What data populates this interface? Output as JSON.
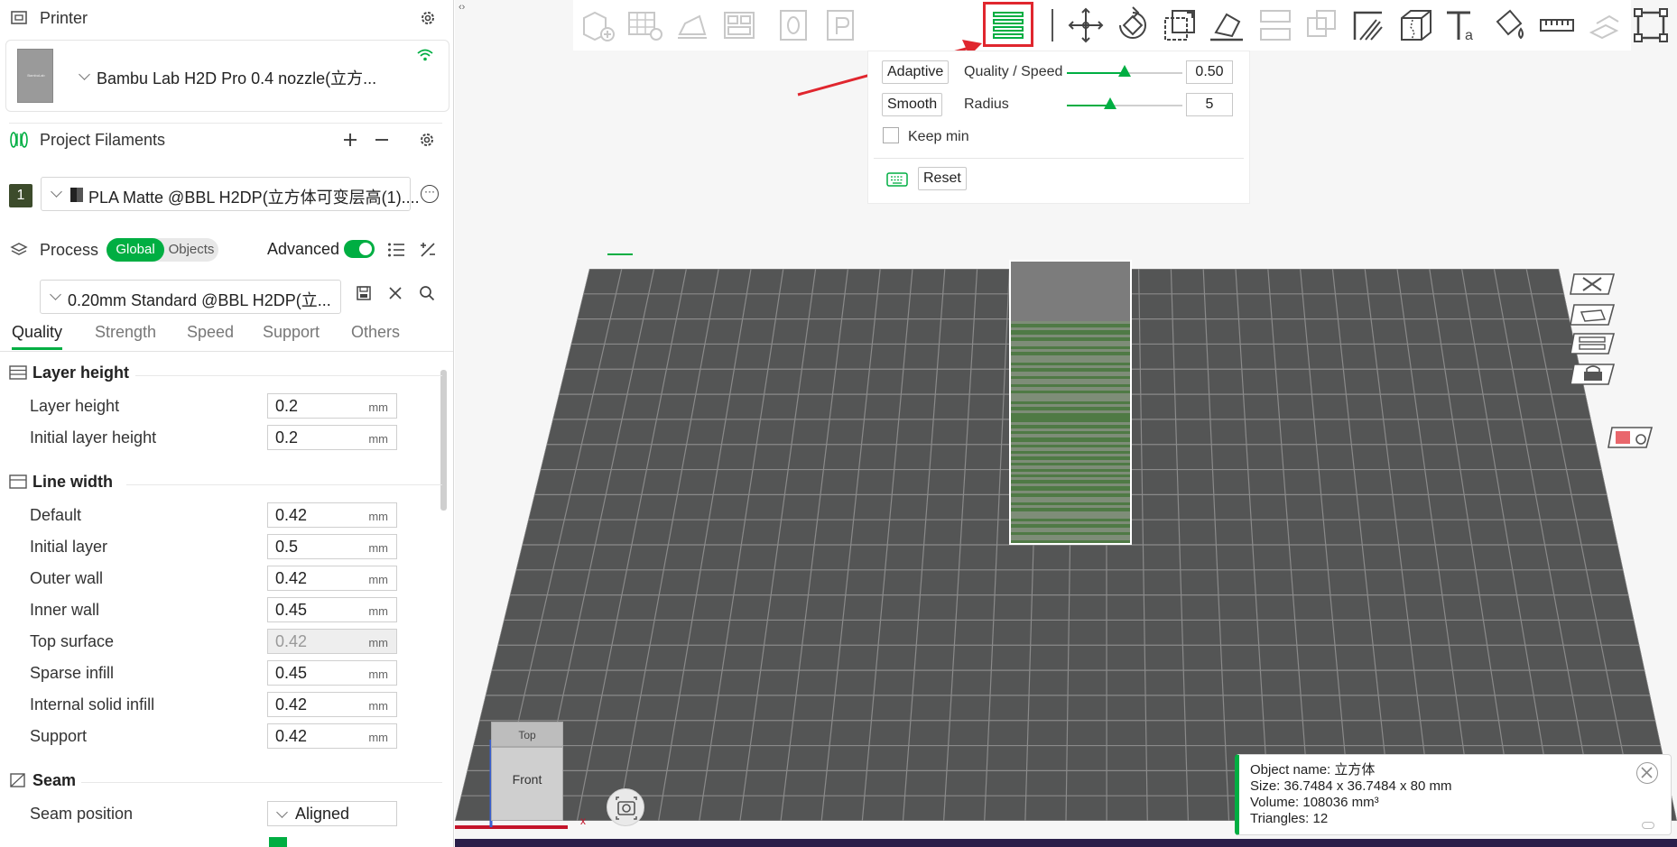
{
  "printer": {
    "section_title": "Printer",
    "name": "Bambu Lab H2D Pro 0.4 nozzle(立方...",
    "thumb_text": "BambuLab"
  },
  "filaments": {
    "section_title": "Project Filaments",
    "items": [
      {
        "index": "1",
        "name": "PLA Matte @BBL H2DP(立方体可变层高(1)....",
        "color": "#3c4b2b"
      }
    ]
  },
  "process": {
    "section_title": "Process",
    "toggle_global": "Global",
    "toggle_objects": "Objects",
    "advanced_label": "Advanced",
    "advanced_on": true,
    "preset": "0.20mm Standard @BBL H2DP(立..."
  },
  "tabs": [
    "Quality",
    "Strength",
    "Speed",
    "Support",
    "Others"
  ],
  "active_tab": "Quality",
  "groups": {
    "layer_height": {
      "title": "Layer height",
      "rows": [
        {
          "label": "Layer height",
          "value": "0.2",
          "unit": "mm"
        },
        {
          "label": "Initial layer height",
          "value": "0.2",
          "unit": "mm"
        }
      ]
    },
    "line_width": {
      "title": "Line width",
      "rows": [
        {
          "label": "Default",
          "value": "0.42",
          "unit": "mm"
        },
        {
          "label": "Initial layer",
          "value": "0.5",
          "unit": "mm"
        },
        {
          "label": "Outer wall",
          "value": "0.42",
          "unit": "mm"
        },
        {
          "label": "Inner wall",
          "value": "0.45",
          "unit": "mm"
        },
        {
          "label": "Top surface",
          "value": "0.42",
          "unit": "mm"
        },
        {
          "label": "Sparse infill",
          "value": "0.45",
          "unit": "mm"
        },
        {
          "label": "Internal solid infill",
          "value": "0.42",
          "unit": "mm"
        },
        {
          "label": "Support",
          "value": "0.42",
          "unit": "mm"
        }
      ]
    },
    "seam": {
      "title": "Seam",
      "rows": [
        {
          "label": "Seam position",
          "value": "Aligned"
        }
      ]
    }
  },
  "layer_panel": {
    "adaptive_button": "Adaptive",
    "quality_label": "Quality / Speed",
    "quality_value": "0.50",
    "quality_level": 0.5,
    "smooth_button": "Smooth",
    "radius_label": "Radius",
    "radius_value": "5",
    "keep_min_label": "Keep min",
    "keep_min_checked": false,
    "reset_button": "Reset"
  },
  "viewcube": {
    "top": "Top",
    "front": "Front",
    "axis_x": "x"
  },
  "object_info": {
    "name_line": "Object name: 立方体",
    "size_line": "Size: 36.7484 x 36.7484 x 80 mm",
    "volume_line": "Volume: 108036 mm³",
    "triangles_line": "Triangles: 12"
  },
  "colors": {
    "accent": "#00ae42",
    "highlight": "#e0262e",
    "plate": "#545555",
    "grid": "#8a8a8a"
  }
}
